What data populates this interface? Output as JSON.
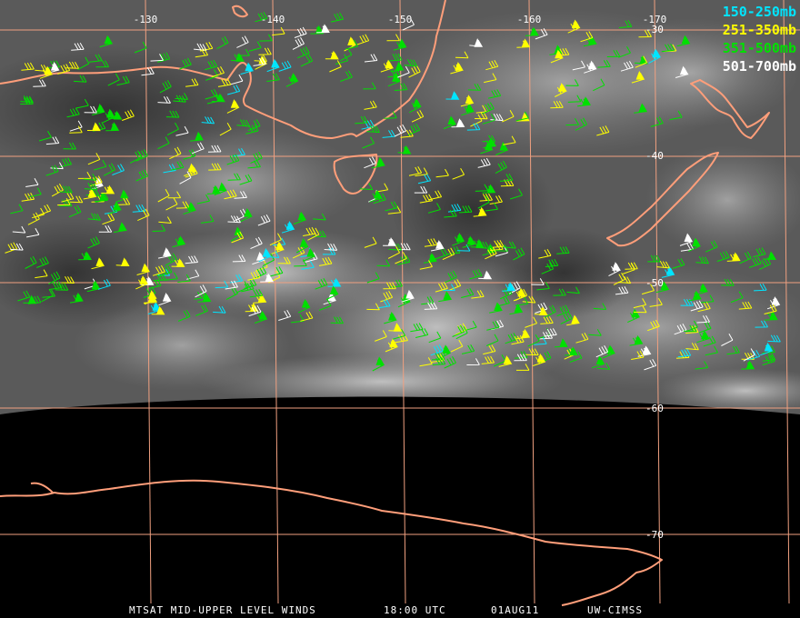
{
  "map": {
    "grid_color": "#f0a080",
    "coast_color": "#ff9e7a",
    "longitude_labels": [
      "-130",
      "-140",
      "-150",
      "-160",
      "-170"
    ],
    "latitude_labels": [
      "-30",
      "-40",
      "-50",
      "-60",
      "-70"
    ]
  },
  "legend": [
    {
      "label": "150-250mb",
      "color": "#00e5ff"
    },
    {
      "label": "251-350mb",
      "color": "#ffff00"
    },
    {
      "label": "351-500mb",
      "color": "#00e000"
    },
    {
      "label": "501-700mb",
      "color": "#ffffff"
    }
  ],
  "footer": {
    "product": "MTSAT MID-UPPER LEVEL WINDS",
    "time": "18:00 UTC",
    "date": "01AUG11",
    "source": "UW-CIMSS"
  }
}
